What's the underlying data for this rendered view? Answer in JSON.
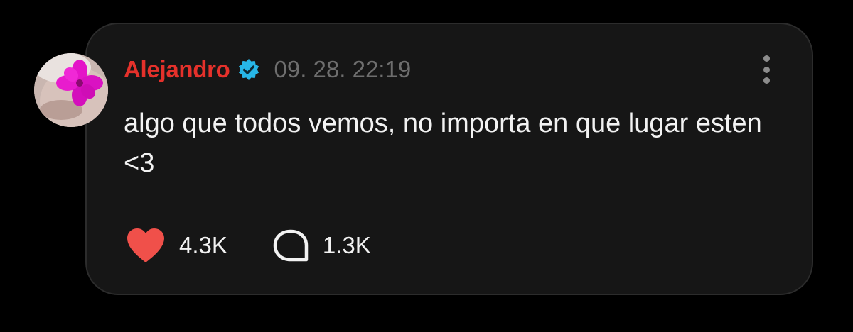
{
  "post": {
    "author": "Alejandro",
    "verified": true,
    "timestamp": "09. 28. 22:19",
    "text": "algo que todos vemos, no importa en que lugar esten <3",
    "likes": "4.3K",
    "comments": "1.3K"
  },
  "icons": {
    "verified": "verified-badge-icon",
    "more": "more-vertical-icon",
    "like": "heart-icon",
    "comment": "comment-bubble-icon"
  },
  "colors": {
    "background": "#000000",
    "card": "#161616",
    "author": "#e5312b",
    "verified": "#27b7e8",
    "heart": "#f0504a",
    "timestamp": "#6e6e6e",
    "text": "#f2f2f2"
  }
}
